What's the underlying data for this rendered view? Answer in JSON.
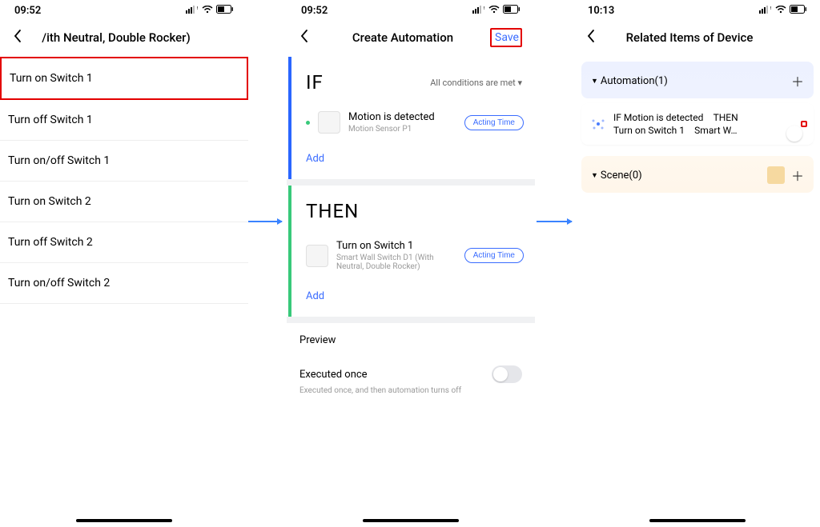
{
  "status": {
    "time_a": "09:52",
    "time_b": "09:52",
    "time_c": "10:13"
  },
  "phone1": {
    "title": "/ith Neutral, Double Rocker)",
    "items": [
      "Turn on Switch 1",
      "Turn off Switch 1",
      "Turn on/off Switch 1",
      "Turn on Switch 2",
      "Turn off Switch 2",
      "Turn on/off Switch 2"
    ]
  },
  "phone2": {
    "title": "Create Automation",
    "save": "Save",
    "if_label": "IF",
    "if_cond_sub": "All conditions are met ▾",
    "if_item_title": "Motion is detected",
    "if_item_sub": "Motion Sensor P1",
    "acting": "Acting Time",
    "add": "Add",
    "then_label": "THEN",
    "then_item_title": "Turn on Switch 1",
    "then_item_sub": "Smart Wall Switch D1 (With Neutral, Double Rocker)",
    "preview": "Preview",
    "exec_title": "Executed once",
    "exec_sub": "Executed once, and then automation turns off"
  },
  "phone3": {
    "title": "Related Items of Device",
    "automation_group": "Automation(1)",
    "scene_group": "Scene(0)",
    "item_line1": "IF Motion is detected THEN",
    "item_line2": "Turn on Switch 1 Smart W…"
  }
}
